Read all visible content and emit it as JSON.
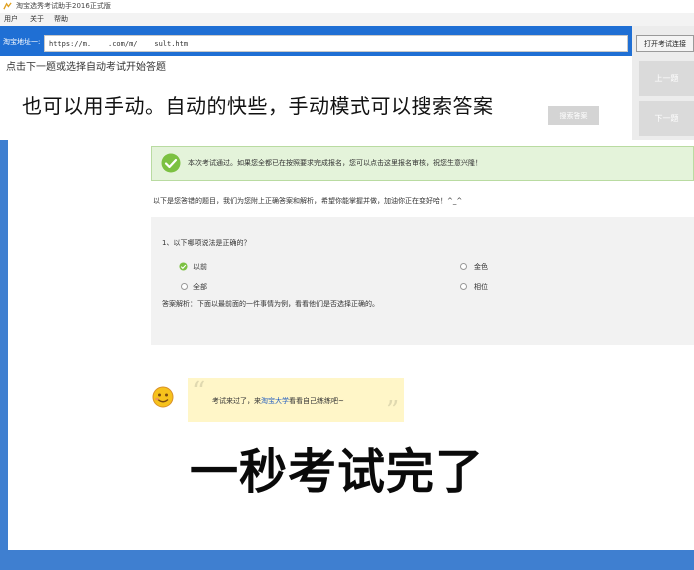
{
  "window": {
    "title": "淘宝选秀考试助手2016正式版",
    "menu": [
      "用户",
      "关于",
      "帮助"
    ]
  },
  "header": {
    "address_label": "淘宝地址一:",
    "address_value": "https://m.    .com/m/    sult.htm",
    "hint": "点击下一题或选择自动考试开始答题",
    "search_button": "搜索答案"
  },
  "right_panel": {
    "open_button": "打开考试连接",
    "prev_button": "上一题",
    "next_button": "下一题"
  },
  "overlay": {
    "line1": "也可以用手动。自动的快些，手动模式可以搜索答案",
    "line2": "一秒考试完了"
  },
  "result": {
    "success": "本次考试通过。如果您全都已在按照要求完成报名，您可以点击这里报名审核，祝您生意兴隆！",
    "intro": "以下是您答错的题目，我们为您附上正确答案和解析，希望你能掌握并做，加油你正在变好哈！^_^"
  },
  "question": {
    "title": "1、以下哪项说法是正确的？",
    "options": [
      "以前",
      "金色",
      "全部",
      "相位"
    ],
    "analysis": "答案解析：下面以最前面的一件事情为例，看看他们是否选择正确的。"
  },
  "bubble": {
    "prefix": "考试来过了，来",
    "link": "淘宝大学",
    "suffix": "看看自己练练吧~"
  },
  "colors": {
    "header_blue": "#1f6fd4",
    "success_green": "#7cc142",
    "bubble_yellow": "#fff6c8"
  },
  "icons": [
    "app-icon",
    "check-icon",
    "radio-selected-icon",
    "radio-icon",
    "emoji-icon"
  ]
}
